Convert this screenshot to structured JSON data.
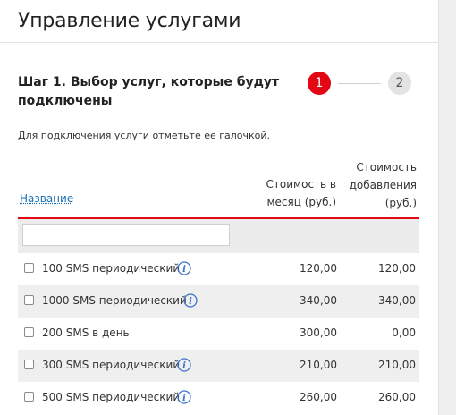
{
  "page": {
    "title": "Управление услугами"
  },
  "step": {
    "title": "Шаг 1. Выбор услуг, которые будут подключены",
    "current": "1",
    "next": "2"
  },
  "hint": "Для подключения услуги отметьте ее галочкой.",
  "table": {
    "col_name": "Название",
    "col_month": "Стоимость в месяц (руб.)",
    "col_add": "Стоимость добавления (руб.)",
    "filter_value": "",
    "rows": [
      {
        "name": "100 SMS периодический",
        "info": true,
        "month": "120,00",
        "add": "120,00",
        "checked": false
      },
      {
        "name": "1000 SMS периодический",
        "info": true,
        "month": "340,00",
        "add": "340,00",
        "checked": false
      },
      {
        "name": "200 SMS в день",
        "info": false,
        "month": "300,00",
        "add": "0,00",
        "checked": false
      },
      {
        "name": "300 SMS периодический",
        "info": true,
        "month": "210,00",
        "add": "210,00",
        "checked": false
      },
      {
        "name": "500 SMS периодический",
        "info": true,
        "month": "260,00",
        "add": "260,00",
        "checked": false
      }
    ]
  },
  "colors": {
    "accent": "#e30613",
    "link": "#1a6fb5",
    "info_icon": "#3a74c9",
    "row_alt": "#efefef"
  },
  "icons": {
    "row_info": "info-icon"
  }
}
